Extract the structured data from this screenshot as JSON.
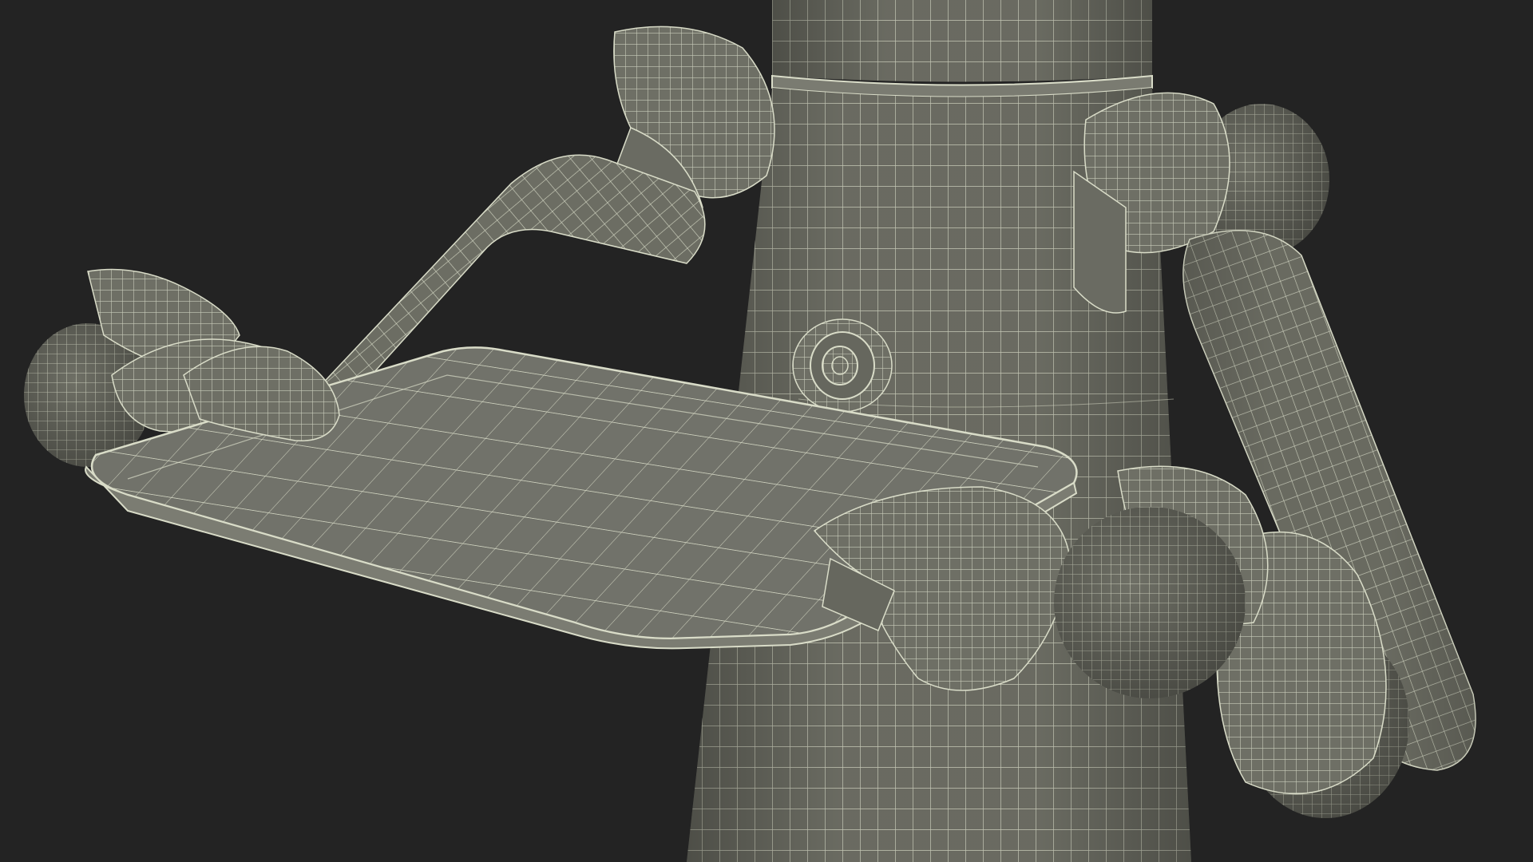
{
  "scene": {
    "subject": "robot-waiter-wireframe",
    "colors": {
      "background": "#232323",
      "surface": "#6f7066",
      "surface_dark": "#5e5f56",
      "surface_light": "#7c7d73",
      "wire": "#d9dcc8",
      "wire_faint": "#b9bca8"
    }
  }
}
